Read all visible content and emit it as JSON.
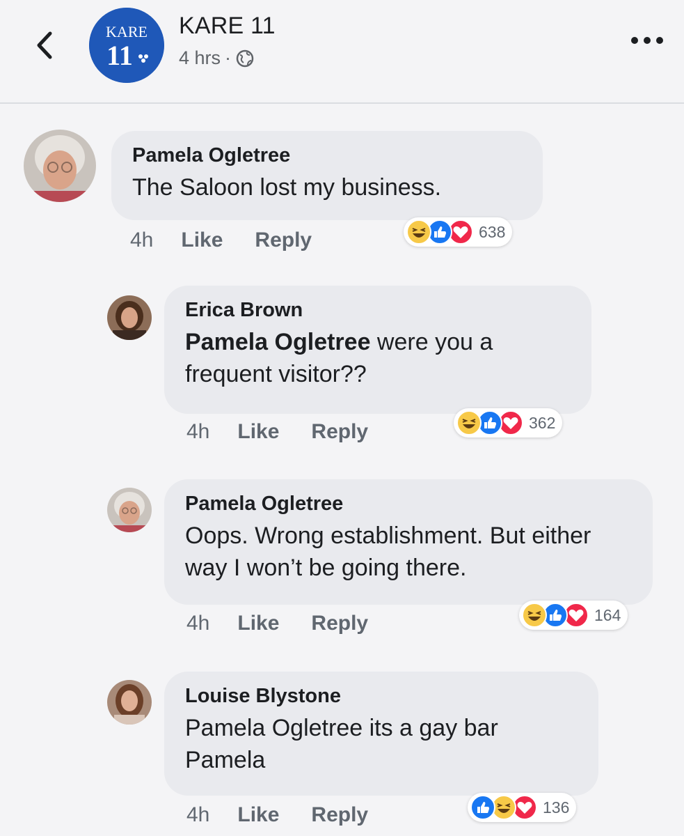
{
  "header": {
    "page_name": "KARE 11",
    "time": "4 hrs",
    "separator": "·",
    "logo_text_top": "KARE",
    "logo_text_num": "11"
  },
  "comments": [
    {
      "author": "Pamela Ogletree",
      "mention": "",
      "text": "The Saloon lost my business.",
      "time": "4h",
      "like_label": "Like",
      "reply_label": "Reply",
      "reaction_icons": [
        "haha-icon",
        "like-icon",
        "love-icon"
      ],
      "reaction_count": "638"
    },
    {
      "author": "Erica Brown",
      "mention": "Pamela Ogletree",
      "text": " were you a frequent visitor??",
      "time": "4h",
      "like_label": "Like",
      "reply_label": "Reply",
      "reaction_icons": [
        "haha-icon",
        "like-icon",
        "love-icon"
      ],
      "reaction_count": "362"
    },
    {
      "author": "Pamela Ogletree",
      "mention": "",
      "text": "Oops. Wrong establishment. But either way I won’t be going there.",
      "time": "4h",
      "like_label": "Like",
      "reply_label": "Reply",
      "reaction_icons": [
        "haha-icon",
        "like-icon",
        "love-icon"
      ],
      "reaction_count": "164"
    },
    {
      "author": "Louise Blystone",
      "mention": "",
      "text": "Pamela Ogletree its a gay bar Pamela",
      "time": "4h",
      "like_label": "Like",
      "reply_label": "Reply",
      "reaction_icons": [
        "like-icon",
        "haha-icon",
        "love-icon"
      ],
      "reaction_count": "136"
    }
  ],
  "colors": {
    "background": "#f4f4f6",
    "bubble": "#e9eaee",
    "brand_blue": "#1f58b8",
    "like_blue": "#1877f2",
    "love_red": "#f0284a",
    "haha_yellow": "#f7c948"
  }
}
